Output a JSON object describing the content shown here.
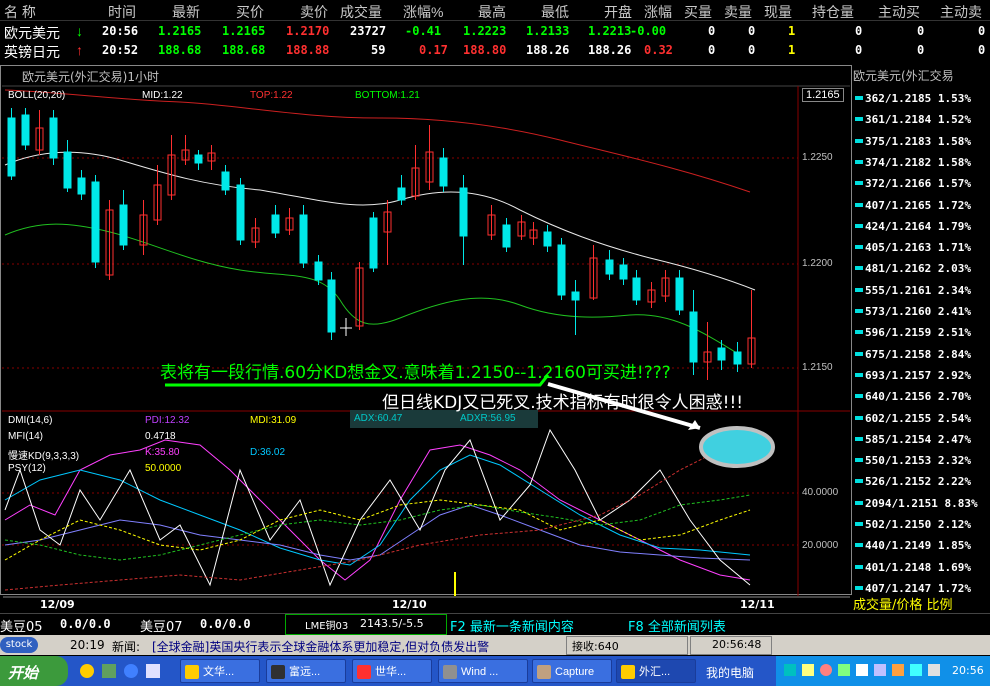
{
  "header": {
    "columns": [
      "名 称",
      "时间",
      "最新",
      "买价",
      "卖价",
      "成交量",
      "涨幅%",
      "最高",
      "最低",
      "开盘",
      "涨幅",
      "买量",
      "卖量",
      "现量",
      "持仓量",
      "主动买",
      "主动卖"
    ]
  },
  "quotes": [
    {
      "name": "欧元美元",
      "arrow": "↓",
      "time": "20:56",
      "last": "1.2165",
      "bid": "1.2165",
      "ask": "1.2170",
      "volume": "23727",
      "change_pct": "-0.41",
      "high": "1.2223",
      "low": "1.2133",
      "open": "1.2213",
      "change": "-0.00",
      "bid_vol": "0",
      "ask_vol": "0",
      "cur_vol": "1",
      "open_int": "0",
      "active_buy": "0",
      "active_sell": "0"
    },
    {
      "name": "英镑日元",
      "arrow": "↑",
      "time": "20:52",
      "last": "188.68",
      "bid": "188.68",
      "ask": "188.88",
      "volume": "59",
      "change_pct": "0.17",
      "high": "188.80",
      "low": "188.26",
      "open": "188.26",
      "change": "0.32",
      "bid_vol": "0",
      "ask_vol": "0",
      "cur_vol": "1",
      "open_int": "0",
      "active_buy": "0",
      "active_sell": "0"
    }
  ],
  "chart": {
    "title": "欧元美元(外汇交易)1小时",
    "boll": {
      "label": "BOLL(20,20)",
      "mid": "MID:1.22",
      "top": "TOP:1.22",
      "bottom": "BOTTOM:1.21"
    },
    "price_box": "1.2165",
    "price_ticks": [
      "1.2250",
      "1.2200",
      "1.2150"
    ],
    "indicators": {
      "dmi": "DMI(14,6)",
      "pdi": "PDI:12.32",
      "mdi": "MDI:31.09",
      "adx": "ADX:60.47",
      "adxr": "ADXR:56.95",
      "mfi": "MFI(14)",
      "mfi_val": "0.4718",
      "kd": "慢速KD(9,3,3,3)",
      "k": "K:35.80",
      "d": "D:36.02",
      "psy": "PSY(12)",
      "psy_val": "50.0000"
    },
    "ind_ticks": [
      "40.0000",
      "20.0000"
    ],
    "annotation_1": "表将有一段行情.60分KD想金叉.意味着1.2150--1.2160可买进!???",
    "annotation_2": "但日线KDJ又已死叉.技术指标有时很令人困惑!!!",
    "x_labels": [
      "12/09",
      "12/10",
      "12/11"
    ]
  },
  "right_panel": {
    "title": "欧元美元(外汇交易",
    "ticks": [
      {
        "vol": "362",
        "price": "1.2185",
        "pct": "1.53%"
      },
      {
        "vol": "361",
        "price": "1.2184",
        "pct": "1.52%"
      },
      {
        "vol": "375",
        "price": "1.2183",
        "pct": "1.58%"
      },
      {
        "vol": "374",
        "price": "1.2182",
        "pct": "1.58%"
      },
      {
        "vol": "372",
        "price": "1.2166",
        "pct": "1.57%"
      },
      {
        "vol": "407",
        "price": "1.2165",
        "pct": "1.72%"
      },
      {
        "vol": "424",
        "price": "1.2164",
        "pct": "1.79%"
      },
      {
        "vol": "405",
        "price": "1.2163",
        "pct": "1.71%"
      },
      {
        "vol": "481",
        "price": "1.2162",
        "pct": "2.03%"
      },
      {
        "vol": "555",
        "price": "1.2161",
        "pct": "2.34%"
      },
      {
        "vol": "573",
        "price": "1.2160",
        "pct": "2.41%"
      },
      {
        "vol": "596",
        "price": "1.2159",
        "pct": "2.51%"
      },
      {
        "vol": "675",
        "price": "1.2158",
        "pct": "2.84%"
      },
      {
        "vol": "693",
        "price": "1.2157",
        "pct": "2.92%"
      },
      {
        "vol": "640",
        "price": "1.2156",
        "pct": "2.70%"
      },
      {
        "vol": "602",
        "price": "1.2155",
        "pct": "2.54%"
      },
      {
        "vol": "585",
        "price": "1.2154",
        "pct": "2.47%"
      },
      {
        "vol": "550",
        "price": "1.2153",
        "pct": "2.32%"
      },
      {
        "vol": "526",
        "price": "1.2152",
        "pct": "2.22%"
      },
      {
        "vol": "2094",
        "price": "1.2151",
        "pct": "8.83%"
      },
      {
        "vol": "502",
        "price": "1.2150",
        "pct": "2.12%"
      },
      {
        "vol": "440",
        "price": "1.2149",
        "pct": "1.85%"
      },
      {
        "vol": "401",
        "price": "1.2148",
        "pct": "1.69%"
      },
      {
        "vol": "407",
        "price": "1.2147",
        "pct": "1.72%"
      }
    ],
    "footer": "成交量/价格 比例"
  },
  "bottom_bar": {
    "items": [
      {
        "name": "美豆05",
        "value": "0.0/0.0"
      },
      {
        "name": "美豆07",
        "value": "0.0/0.0"
      },
      {
        "name": "LME铜03",
        "value": "2143.5/-5.5"
      }
    ],
    "f2": "F2 最新一条新闻内容",
    "f8": "F8 全部新闻列表"
  },
  "news_bar": {
    "logo": "stock",
    "time": "20:19",
    "label": "新闻:",
    "headline": "[全球金融]英国央行表示全球金融体系更加稳定,但对负债发出警",
    "recv_label": "接收:640",
    "clock": "20:56:48"
  },
  "taskbar": {
    "start": "开始",
    "buttons": [
      "文华...",
      "富远...",
      "世华...",
      "Wind ...",
      "Capture",
      "外汇..."
    ],
    "my_computer": "我的电脑",
    "time": "20:56"
  },
  "colors": {
    "up": "#ff3030",
    "down": "#00e8e8",
    "yellow": "#ffff00",
    "green": "#00ff00",
    "bg": "#000000"
  }
}
